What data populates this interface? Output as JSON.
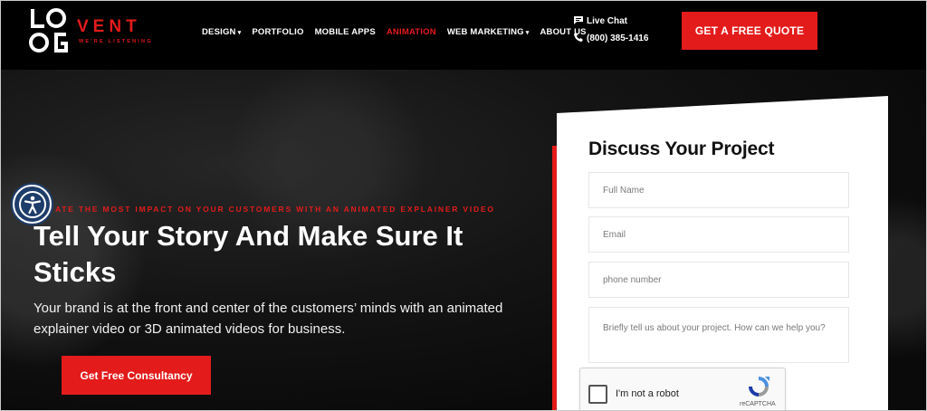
{
  "brand": {
    "word": "VENT",
    "tagline": "WE'RE LISTENING",
    "accent_color": "#e31b1b"
  },
  "nav": {
    "items": [
      {
        "label": "DESIGN",
        "dropdown": true,
        "active": false
      },
      {
        "label": "PORTFOLIO",
        "dropdown": false,
        "active": false
      },
      {
        "label": "MOBILE APPS",
        "dropdown": false,
        "active": false
      },
      {
        "label": "ANIMATION",
        "dropdown": false,
        "active": true
      },
      {
        "label": "WEB MARKETING",
        "dropdown": true,
        "active": false
      },
      {
        "label": "ABOUT US",
        "dropdown": false,
        "active": false
      }
    ]
  },
  "contact": {
    "chat_label": "Live Chat",
    "phone": "(800) 385-1416",
    "chat_icon": "chat-icon",
    "phone_icon": "phone-icon"
  },
  "header": {
    "quote_button": "GET A FREE QUOTE"
  },
  "hero": {
    "kicker": "ATE THE MOST IMPACT ON YOUR CUSTOMERS WITH AN ANIMATED EXPLAINER VIDEO",
    "headline": "Tell Your Story And Make Sure It Sticks",
    "subtext": "Your brand is at the front and center of the customers’ minds with an animated explainer video or 3D animated videos for business.",
    "cta": "Get Free Consultancy"
  },
  "form": {
    "title": "Discuss Your Project",
    "fields": {
      "name_placeholder": "Full Name",
      "email_placeholder": "Email",
      "phone_placeholder": "phone number",
      "message_placeholder": "Briefly tell us about your project. How can we help you?"
    },
    "captcha": {
      "label": "I'm not a robot",
      "brand": "reCAPTCHA"
    }
  }
}
